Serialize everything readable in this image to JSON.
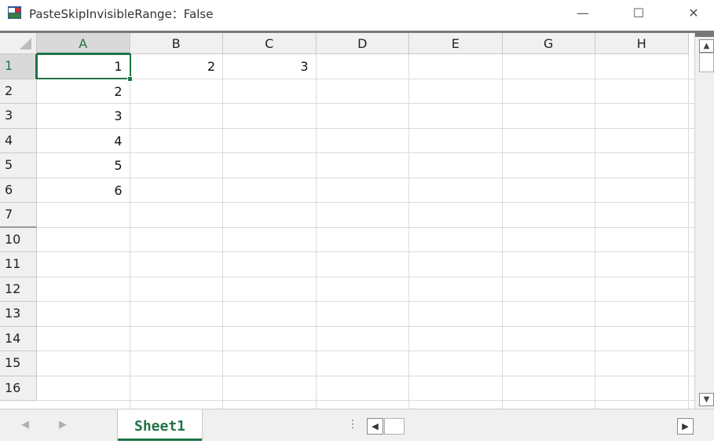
{
  "window": {
    "title": "PasteSkipInvisibleRange：False",
    "minimize_glyph": "—",
    "maximize_glyph": "☐",
    "close_glyph": "✕",
    "icon": "app-icon"
  },
  "sheet": {
    "columns": [
      "A",
      "B",
      "C",
      "D",
      "E",
      "G",
      "H"
    ],
    "rows": [
      "1",
      "2",
      "3",
      "4",
      "5",
      "6",
      "7",
      "10",
      "11",
      "12",
      "13",
      "14",
      "15",
      "16"
    ],
    "cells": {
      "A1": "1",
      "B1": "2",
      "C1": "3",
      "A2": "2",
      "A3": "3",
      "A4": "4",
      "A5": "5",
      "A6": "6"
    },
    "active_cell": "A1",
    "accent_color": "#217346"
  },
  "tabs": {
    "sheets": [
      "Sheet1"
    ],
    "active": "Sheet1"
  },
  "scroll": {
    "up_glyph": "▲",
    "down_glyph": "▼",
    "left_glyph": "◀",
    "right_glyph": "▶",
    "splitter_glyph": "⋮",
    "tab_prev_glyph": "◀",
    "tab_next_glyph": "▶"
  }
}
